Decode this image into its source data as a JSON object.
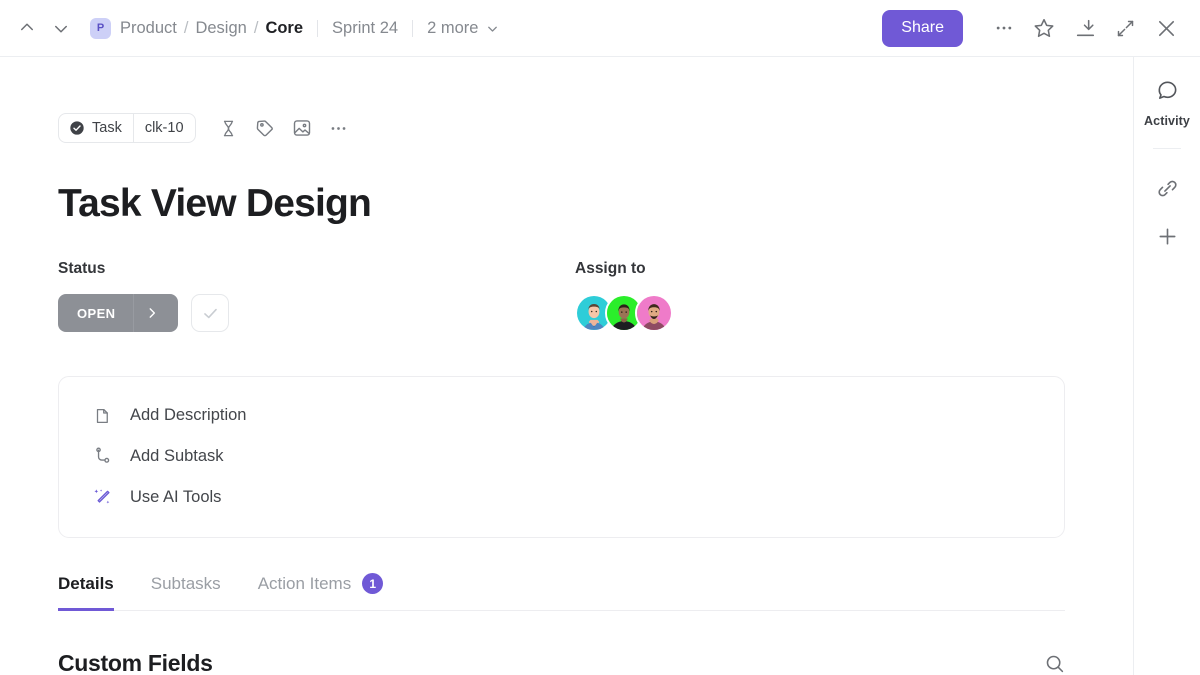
{
  "header": {
    "nav": {
      "prev_icon": "chevron-up-icon",
      "next_icon": "chevron-down-icon"
    },
    "project_badge": "P",
    "breadcrumb": [
      {
        "label": "Product",
        "current": false
      },
      {
        "label": "Design",
        "current": false
      },
      {
        "label": "Core",
        "current": true
      }
    ],
    "separator": "/",
    "sprint": "Sprint 24",
    "more": "2 more",
    "share_label": "Share",
    "actions": [
      "more-options-icon",
      "star-icon",
      "download-icon",
      "collapse-icon",
      "close-icon"
    ],
    "accent_color": "#7059d6"
  },
  "task": {
    "type_label": "Task",
    "type_icon": "check-circle-icon",
    "id_label": "clk-10",
    "meta_icons": [
      "hourglass-icon",
      "tag-icon",
      "image-icon",
      "more-options-icon"
    ],
    "title": "Task View Design"
  },
  "status": {
    "label": "Status",
    "value": "OPEN",
    "chip_color": "#8d9096",
    "expand_icon": "chevron-right-icon",
    "complete_icon": "check-icon"
  },
  "assignees": {
    "label": "Assign to",
    "avatars": [
      {
        "name": "avatar-1",
        "bg": "#2ecdd8"
      },
      {
        "name": "avatar-2",
        "bg": "#2bee2b"
      },
      {
        "name": "avatar-3",
        "bg": "#ef7bc9"
      }
    ]
  },
  "quick_actions": [
    {
      "label": "Add Description",
      "icon": "document-icon"
    },
    {
      "label": "Add Subtask",
      "icon": "subtask-icon"
    },
    {
      "label": "Use AI Tools",
      "icon": "ai-wand-icon",
      "accent": "#6b5bd6"
    }
  ],
  "tabs": [
    {
      "label": "Details",
      "active": true,
      "badge": ""
    },
    {
      "label": "Subtasks",
      "active": false,
      "badge": ""
    },
    {
      "label": "Action Items",
      "active": false,
      "badge": "1"
    }
  ],
  "custom_fields": {
    "title": "Custom Fields",
    "search_icon": "search-icon"
  },
  "rail": {
    "activity_label": "Activity",
    "activity_icon": "comment-icon",
    "link_icon": "link-icon",
    "add_icon": "plus-icon"
  }
}
